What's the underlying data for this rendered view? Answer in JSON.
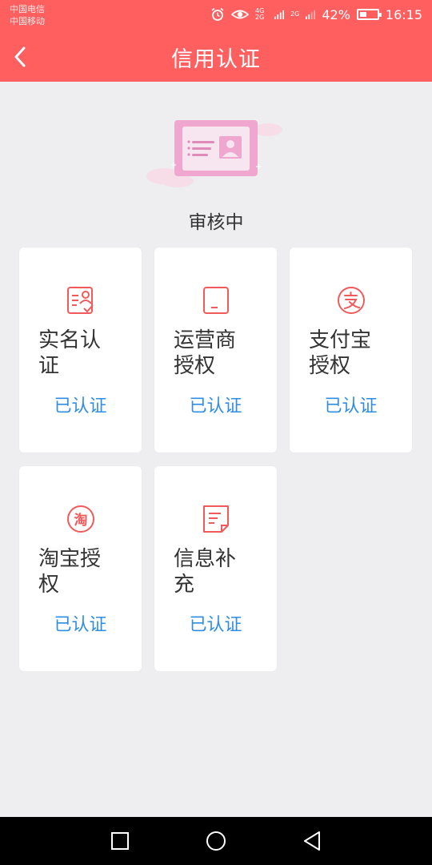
{
  "status_bar": {
    "carrier_1": "中国电信",
    "carrier_2": "中国移动",
    "network_1": "4G 2G",
    "network_2": "2G",
    "battery": "42%",
    "battery_level": 0.42,
    "time": "16:15"
  },
  "header": {
    "title": "信用认证",
    "bg_color": "#FF5F5F"
  },
  "hero": {
    "status": "审核中"
  },
  "cards": [
    {
      "title": "实名认证",
      "status": "已认证",
      "icon": "id-card-icon"
    },
    {
      "title": "运营商授权",
      "status": "已认证",
      "icon": "phone-icon"
    },
    {
      "title": "支付宝授权",
      "status": "已认证",
      "icon": "alipay-icon"
    },
    {
      "title": "淘宝授权",
      "status": "已认证",
      "icon": "taobao-icon"
    },
    {
      "title": "信息补充",
      "status": "已认证",
      "icon": "document-icon"
    }
  ],
  "colors": {
    "accent": "#FF5F5F",
    "icon": "#F05A5A",
    "verified": "#2F8DE4",
    "background": "#EEEEF0"
  }
}
